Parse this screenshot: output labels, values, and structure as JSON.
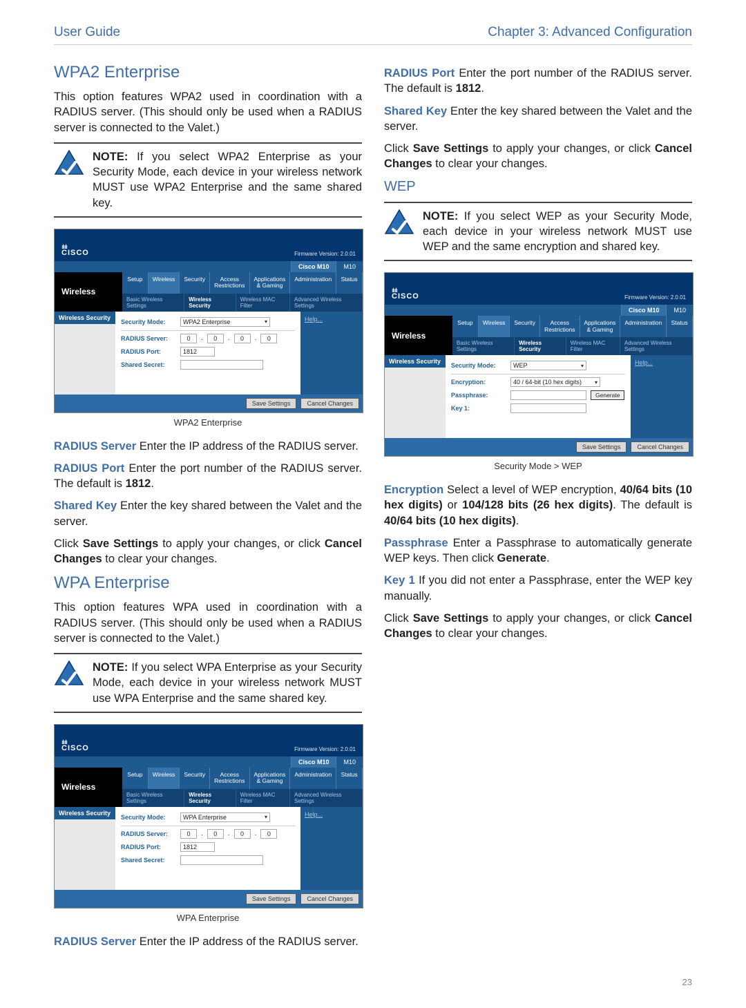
{
  "header": {
    "left": "User Guide",
    "right": "Chapter 3: Advanced Configuration"
  },
  "left_col": {
    "h_wpa2": "WPA2 Enterprise",
    "p_wpa2_intro": "This option features WPA2 used in coordination with a RADIUS server. (This should only be used when a RADIUS server is connected to the Valet.)",
    "note_wpa2_label": "NOTE:",
    "note_wpa2_body": " If you select WPA2 Enterprise as your Security Mode, each device in your wireless network MUST use WPA2 Enterprise and the same shared key.",
    "shot1_caption": "WPA2 Enterprise",
    "radius_server_label": "RADIUS Server",
    "radius_server_text": "  Enter the IP address of the RADIUS server.",
    "radius_port_label": "RADIUS Port",
    "radius_port_text_a": "  Enter the port number of the RADIUS server. The default is ",
    "radius_port_text_b": "1812",
    "radius_port_text_c": ".",
    "shared_key_label": "Shared Key",
    "shared_key_text": "  Enter the key shared between the Valet and the server.",
    "save_text_a": "Click ",
    "save_text_b": "Save Settings",
    "save_text_c": " to apply your changes, or click ",
    "save_text_d": "Cancel Changes",
    "save_text_e": " to clear your changes.",
    "h_wpa": "WPA Enterprise",
    "p_wpa_intro": "This option features WPA used in coordination with a RADIUS server. (This should only be used when a RADIUS server is connected to the Valet.)",
    "note_wpa_label": "NOTE:",
    "note_wpa_body": " If you select WPA Enterprise as your Security Mode, each device in your wireless network MUST use WPA Enterprise and the same shared key.",
    "shot2_caption": "WPA Enterprise",
    "radius_server2_label": "RADIUS Server",
    "radius_server2_text": "  Enter the IP address of the RADIUS server."
  },
  "right_col": {
    "radius_port_label": "RADIUS Port",
    "radius_port_text_a": "  Enter the port number of the RADIUS server. The default is ",
    "radius_port_text_b": "1812",
    "radius_port_text_c": ".",
    "shared_key_label": "Shared Key",
    "shared_key_text": "  Enter the key shared between the Valet and the server.",
    "save_text_a": "Click ",
    "save_text_b": "Save Settings",
    "save_text_c": " to apply your changes, or click ",
    "save_text_d": "Cancel Changes",
    "save_text_e": " to clear your changes.",
    "h_wep": "WEP",
    "note_wep_label": "NOTE:",
    "note_wep_body": " If you select WEP as your Security Mode, each device in your wireless network MUST use WEP and the same encryption and shared key.",
    "shot3_caption": "Security Mode > WEP",
    "enc_label": "Encryption",
    "enc_text_a": "  Select a level of WEP encryption, ",
    "enc_text_b": "40/64 bits (10 hex digits)",
    "enc_text_c": " or ",
    "enc_text_d": "104/128 bits (26 hex digits)",
    "enc_text_e": ". The default is ",
    "enc_text_f": "40/64 bits (10 hex digits)",
    "enc_text_g": ".",
    "pass_label": "Passphrase",
    "pass_text_a": "  Enter a Passphrase to automatically generate WEP keys. Then click ",
    "pass_text_b": "Generate",
    "pass_text_c": ".",
    "key1_label": "Key 1",
    "key1_text": "  If you did not enter a Passphrase, enter the WEP key manually.",
    "save2_a": "Click ",
    "save2_b": "Save Settings",
    "save2_c": " to apply your changes, or click ",
    "save2_d": "Cancel Changes",
    "save2_e": " to clear your changes."
  },
  "router": {
    "brand_bars": "ılıılı",
    "brand": "CISCO",
    "firmware": "Firmware Version: 2.0.01",
    "model_a": "Cisco M10",
    "model_b": "M10",
    "side": "Wireless",
    "tabs": [
      "Setup",
      "Wireless",
      "Security",
      "Access Restrictions",
      "Applications & Gaming",
      "Administration",
      "Status"
    ],
    "sub": [
      "Basic Wireless Settings",
      "Wireless Security",
      "Wireless MAC Filter",
      "Advanced Wireless Settings"
    ],
    "sec_label": "Wireless Security",
    "help": "Help...",
    "f_secmode": "Security Mode:",
    "f_radius_server": "RADIUS Server:",
    "f_radius_port": "RADIUS Port:",
    "f_shared": "Shared Secret:",
    "f_enc": "Encryption:",
    "f_pass": "Passphrase:",
    "f_key1": "Key 1:",
    "val_wpa2": "WPA2 Enterprise",
    "val_wpa": "WPA Enterprise",
    "val_wep": "WEP",
    "val_encsel": "40 / 64-bit (10 hex digits)",
    "ip_zero": "0",
    "port_def": "1812",
    "btn_gen": "Generate",
    "btn_save": "Save Settings",
    "btn_cancel": "Cancel Changes"
  },
  "pagenum": "23"
}
